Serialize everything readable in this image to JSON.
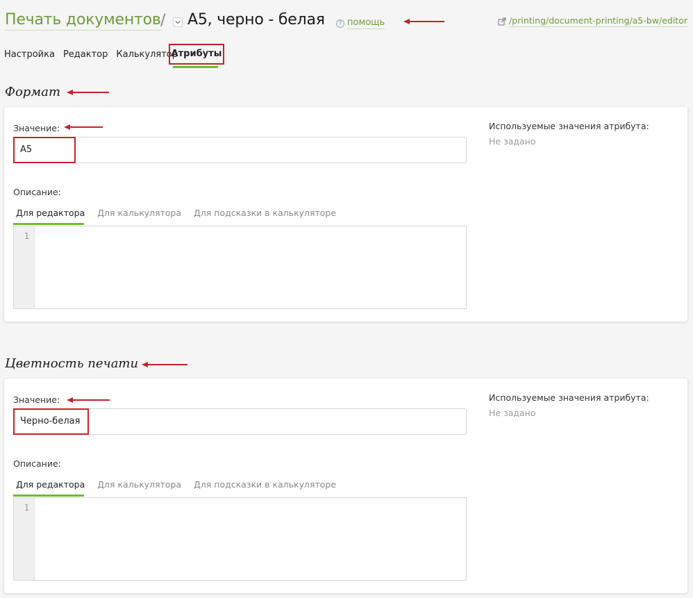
{
  "header": {
    "breadcrumb_root": "Печать документов",
    "separator": "/",
    "title": "A5, черно - белая",
    "help_label": "помощь",
    "url": "/printing/document-printing/a5-bw/editor"
  },
  "tabs": [
    "Настройка",
    "Редактор",
    "Калькулятор",
    "Атрибуты"
  ],
  "active_tab": "Атрибуты",
  "sections": [
    {
      "title": "Формат",
      "value_label": "Значение:",
      "value": "A5",
      "description_label": "Описание:",
      "desc_tabs": [
        "Для редактора",
        "Для калькулятора",
        "Для подсказки в калькуляторе"
      ],
      "line_number": "1",
      "used_values_label": "Используемые значения атрибута:",
      "used_values": "Не задано"
    },
    {
      "title": "Цветность печати",
      "value_label": "Значение:",
      "value": "Черно-белая",
      "description_label": "Описание:",
      "desc_tabs": [
        "Для редактора",
        "Для калькулятора",
        "Для подсказки в калькуляторе"
      ],
      "line_number": "1",
      "used_values_label": "Используемые значения атрибута:",
      "used_values": "Не задано"
    }
  ],
  "colors": {
    "accent_green": "#6ebc32",
    "link_green": "#6f9b3a",
    "annotation_red": "#c8202a",
    "background": "#f5f5f5"
  }
}
